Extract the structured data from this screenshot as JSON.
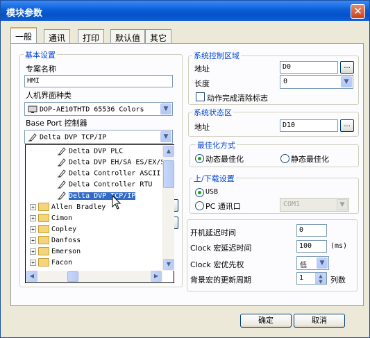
{
  "window": {
    "title": "模块参数",
    "close_glyph": "✕"
  },
  "tabs": [
    "一般",
    "通讯",
    "打印",
    "默认值",
    "其它"
  ],
  "basic": {
    "legend": "基本设置",
    "project_name_label": "专案名称",
    "project_name_value": "HMI",
    "hmi_type_label": "人机界面种类",
    "hmi_type_value": "DOP-AE10THTD 65536 Colors",
    "base_port_label": "Base Port 控制器",
    "controller_value": "Delta DVP TCP/IP"
  },
  "dropdown": {
    "items": [
      {
        "label": "Delta DVP PLC",
        "kind": "driver"
      },
      {
        "label": "Delta DVP EH/SA ES/EX/S",
        "kind": "driver"
      },
      {
        "label": "Delta Controller ASCII",
        "kind": "driver"
      },
      {
        "label": "Delta Controller RTU",
        "kind": "driver"
      },
      {
        "label": "Delta DVP TCP/IP",
        "kind": "driver",
        "selected": true
      },
      {
        "label": "Allen Bradley",
        "kind": "folder"
      },
      {
        "label": "Cimon",
        "kind": "folder"
      },
      {
        "label": "Copley",
        "kind": "folder"
      },
      {
        "label": "Danfoss",
        "kind": "folder"
      },
      {
        "label": "Emerson",
        "kind": "folder"
      },
      {
        "label": "Facon",
        "kind": "folder"
      }
    ],
    "expand_glyph": "+"
  },
  "sys_control": {
    "legend": "系统控制区域",
    "address_label": "地址",
    "address_value": "D0",
    "length_label": "长度",
    "length_value": "0",
    "clear_flag_label": "动作完成清除标志",
    "browse_glyph": "..."
  },
  "sys_status": {
    "legend": "系统状态区",
    "address_label": "地址",
    "address_value": "D10",
    "browse_glyph": "..."
  },
  "optimize": {
    "legend": "最佳化方式",
    "dynamic": "动态最佳化",
    "static": "静态最佳化"
  },
  "transfer": {
    "legend": "上/下载设置",
    "usb": "USB",
    "pc_port": "PC 通讯口",
    "port_value": "COM1"
  },
  "misc": {
    "boot_delay_label": "开机延迟时间",
    "boot_delay_value": "0",
    "clock_delay_label": "Clock 宏延迟时间",
    "clock_delay_value": "100",
    "clock_delay_unit": "(ms)",
    "clock_priority_label": "Clock 宏优先权",
    "clock_priority_value": "低",
    "bg_period_label": "背景宏的更新周期",
    "bg_period_value": "1",
    "bg_period_unit": "列数"
  },
  "buttons": {
    "ok": "确定",
    "cancel": "取消"
  },
  "icons": {
    "dropdown_arrow": "▼",
    "scroll_up": "▲",
    "scroll_down": "▼",
    "scroll_left": "◀",
    "scroll_right": "▶"
  }
}
